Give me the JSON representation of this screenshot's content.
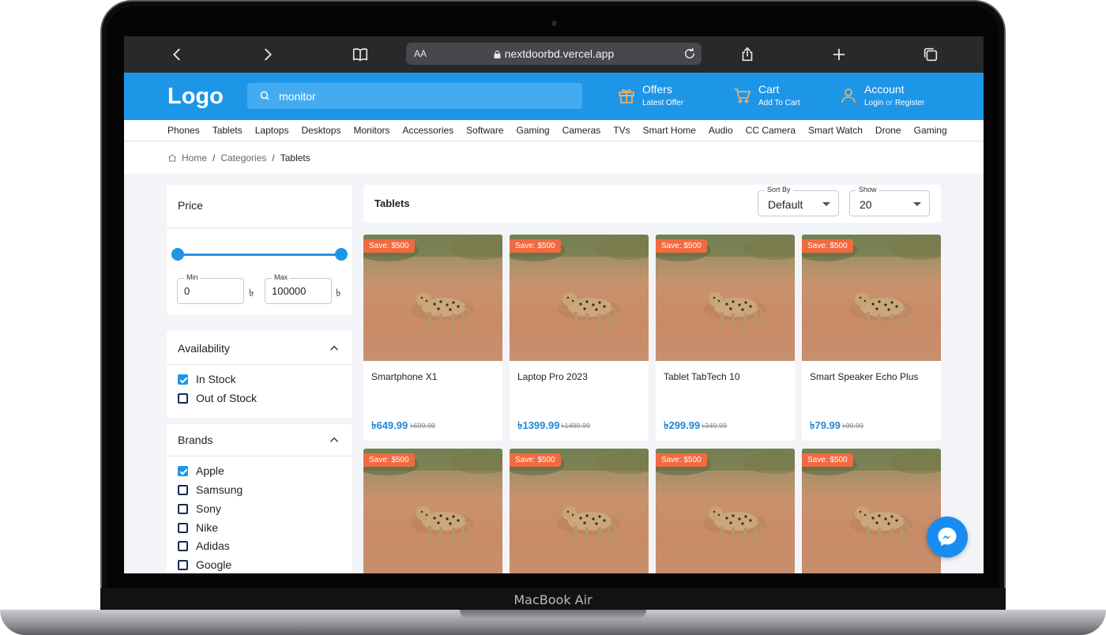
{
  "device": {
    "label": "MacBook Air"
  },
  "browser": {
    "text_size": "AA",
    "url": "nextdoorbd.vercel.app"
  },
  "header": {
    "logo": "Logo",
    "search_value": "monitor",
    "offers": {
      "title": "Offers",
      "subtitle": "Latest Offer",
      "icon": "gift-icon"
    },
    "cart": {
      "title": "Cart",
      "subtitle": "Add To Cart",
      "icon": "cart-icon"
    },
    "account": {
      "title": "Account",
      "login": "Login",
      "or": "or",
      "register": "Register",
      "icon": "user-icon"
    },
    "accent_color": "#1e96e8"
  },
  "categories": [
    "Phones",
    "Tablets",
    "Laptops",
    "Desktops",
    "Monitors",
    "Accessories",
    "Software",
    "Gaming",
    "Cameras",
    "TVs",
    "Smart Home",
    "Audio",
    "CC Camera",
    "Smart Watch",
    "Drone",
    "Gaming"
  ],
  "breadcrumb": {
    "home": "Home",
    "sep": "/",
    "categories": "Categories",
    "current": "Tablets"
  },
  "filters": {
    "price": {
      "title": "Price",
      "min_label": "Min",
      "max_label": "Max",
      "min_value": "0",
      "max_value": "100000",
      "currency": "৳"
    },
    "availability": {
      "title": "Availability",
      "options": [
        {
          "label": "In Stock",
          "checked": true
        },
        {
          "label": "Out of Stock",
          "checked": false
        }
      ]
    },
    "brands": {
      "title": "Brands",
      "options": [
        {
          "label": "Apple",
          "checked": true
        },
        {
          "label": "Samsung",
          "checked": false
        },
        {
          "label": "Sony",
          "checked": false
        },
        {
          "label": "Nike",
          "checked": false
        },
        {
          "label": "Adidas",
          "checked": false
        },
        {
          "label": "Google",
          "checked": false
        }
      ]
    }
  },
  "results": {
    "title": "Tablets",
    "sort": {
      "label": "Sort By",
      "value": "Default"
    },
    "show": {
      "label": "Show",
      "value": "20"
    }
  },
  "products": [
    {
      "badge": "Save: $500",
      "name": "Smartphone X1",
      "price": "৳649.99",
      "old_price": "৳699.99"
    },
    {
      "badge": "Save: $500",
      "name": "Laptop Pro 2023",
      "price": "৳1399.99",
      "old_price": "৳1499.99"
    },
    {
      "badge": "Save: $500",
      "name": "Tablet TabTech 10",
      "price": "৳299.99",
      "old_price": "৳349.99"
    },
    {
      "badge": "Save: $500",
      "name": "Smart Speaker Echo Plus",
      "price": "৳79.99",
      "old_price": "৳99.99"
    },
    {
      "badge": "Save: $500"
    },
    {
      "badge": "Save: $500"
    },
    {
      "badge": "Save: $500"
    },
    {
      "badge": "Save: $500"
    }
  ],
  "chat": {
    "icon": "messenger-icon"
  }
}
